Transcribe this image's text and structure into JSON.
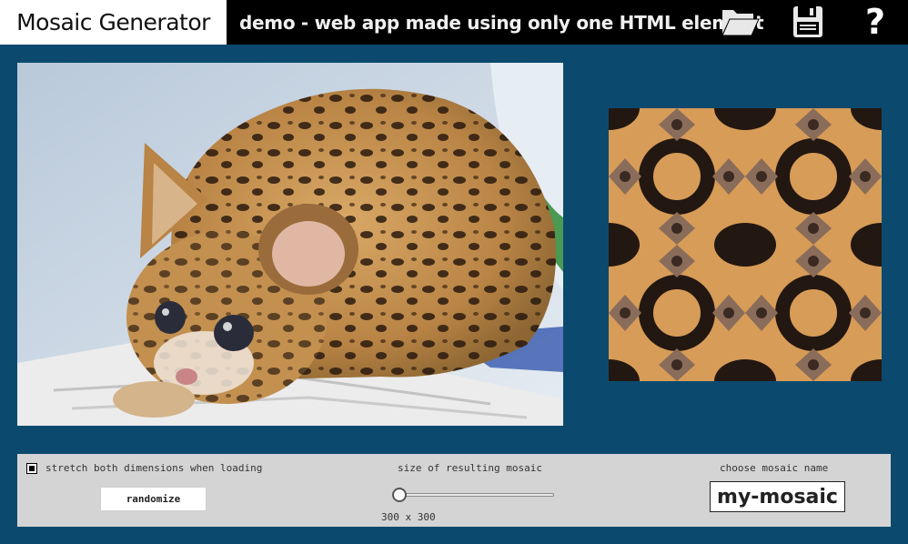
{
  "app": {
    "title": "Mosaic Generator",
    "subtitle": "demo - web app made using only one HTML element"
  },
  "toolbar": {
    "icons": [
      "open-folder-icon",
      "save-floppy-icon",
      "help-question-icon"
    ],
    "help_glyph": "?"
  },
  "images": {
    "source_description": "photo of a spotted wild kitten lying on newspaper",
    "mosaic_description": "kaleidoscopic tiled mosaic generated from the photo"
  },
  "controls": {
    "stretch": {
      "label": "stretch both dimensions when loading",
      "checked": true
    },
    "randomize_label": "randomize",
    "size": {
      "label": "size of resulting mosaic",
      "readout": "300 x 300",
      "value": 300,
      "slider_fraction": 0.0
    },
    "name": {
      "label": "choose mosaic name",
      "value": "my-mosaic"
    }
  },
  "colors": {
    "background": "#0b4a6e",
    "topbar": "#000000",
    "panel": "#d4d4d4",
    "accent_text": "#f0f0f0"
  }
}
